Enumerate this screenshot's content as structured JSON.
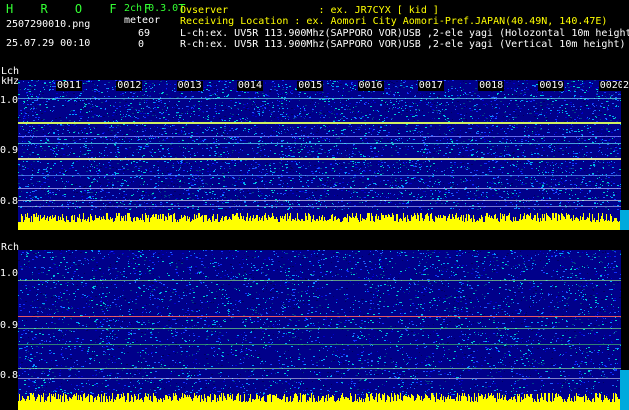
{
  "header": {
    "logo": "H R O F F T",
    "mode": "2ch 0.3.0",
    "filename": "2507290010.png",
    "datetime": "25.07.29 00:10",
    "meteor_label": "meteor",
    "meteor_l": "69",
    "meteor_r": "0",
    "observer": "Ovserver               : ex. JR7CYX [ kid ]",
    "location": "Receiving Location : ex. Aomori City Aomori-Pref.JAPAN(40.49N, 140.47E)",
    "lch_desc": "L-ch:ex. UV5R 113.900Mhz(SAPPORO VOR)USB ,2-ele yagi (Holozontal 10m height)",
    "rch_desc": "R-ch:ex. UV5R 113.900Mhz(SAPPORO VOR)USB ,2-ele yagi (Vertical 10m height)"
  },
  "lch": {
    "label": "Lch",
    "unit": "kHz",
    "freq_labels": [
      "1.0",
      "0.9",
      "0.8"
    ],
    "time_labels": [
      "0011",
      "0012",
      "0013",
      "0014",
      "0015",
      "0016",
      "0017",
      "0018",
      "0019",
      "0020",
      "2"
    ]
  },
  "rch": {
    "label": "Rch",
    "freq_labels": [
      "1.0",
      "0.9",
      "0.8"
    ]
  },
  "colors": {
    "background": "#000000",
    "waterfall_base": "#00008a",
    "signal_yellow": "#ffff00",
    "header_green": "#33ff33",
    "cyan_bar": "#00aadd"
  }
}
